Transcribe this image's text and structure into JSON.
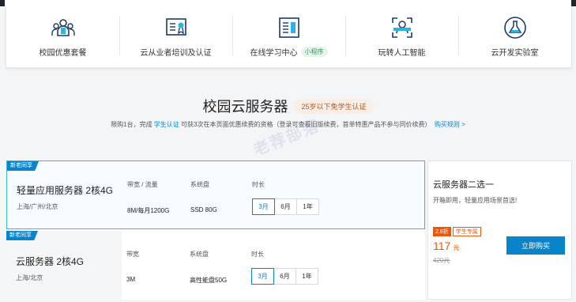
{
  "categories": [
    {
      "label": "校园优惠套餐",
      "icon": "people-icon"
    },
    {
      "label": "云从业者培训及认证",
      "icon": "certificate-icon"
    },
    {
      "label": "在线学习中心",
      "icon": "book-icon",
      "badge": "小程序"
    },
    {
      "label": "玩转人工智能",
      "icon": "ai-face-scan-icon"
    },
    {
      "label": "云开发实验室",
      "icon": "flask-icon"
    }
  ],
  "section": {
    "title": "校园云服务器",
    "age_badge": "25岁以下免学生认证"
  },
  "rules": {
    "pre": "限购1台，完成 ",
    "link1": "学生认证",
    "post": " 可获3次在本页面优惠续费的资格（登录可查看旧版续费，首单特惠产品不参与同价续费）",
    "link2": "购买规则 >"
  },
  "watermark": "老荐部落",
  "products": [
    {
      "tag": "新老同享",
      "name": "轻量应用服务器 2核4G",
      "region": "上海/广州/北京",
      "bandwidth_label": "带宽 / 流量",
      "bandwidth_value": "8M/每月1200G",
      "disk_label": "系统盘",
      "disk_value": "SSD 80G",
      "duration_label": "时长",
      "durations": [
        "3月",
        "6月",
        "1年"
      ]
    },
    {
      "tag": "新老同享",
      "name": "云服务器 2核4G",
      "region": "上海/北京",
      "bandwidth_label": "带宽",
      "bandwidth_value": "3M",
      "disk_label": "系统盘",
      "disk_value": "高性能盘50G",
      "duration_label": "时长",
      "durations": [
        "3月",
        "6月",
        "1年"
      ]
    }
  ],
  "sidecard": {
    "title": "云服务器二选一",
    "subtitle": "开箱即用，轻量应用场景首选!",
    "discount": "2.8折",
    "student_tag": "学生专属",
    "price": "117",
    "price_unit": "元",
    "original_price": "420元",
    "buy_label": "立即购买"
  },
  "colors": {
    "accent": "#0a84c8",
    "price": "#e8590c",
    "header_bg": "#1f2430"
  }
}
